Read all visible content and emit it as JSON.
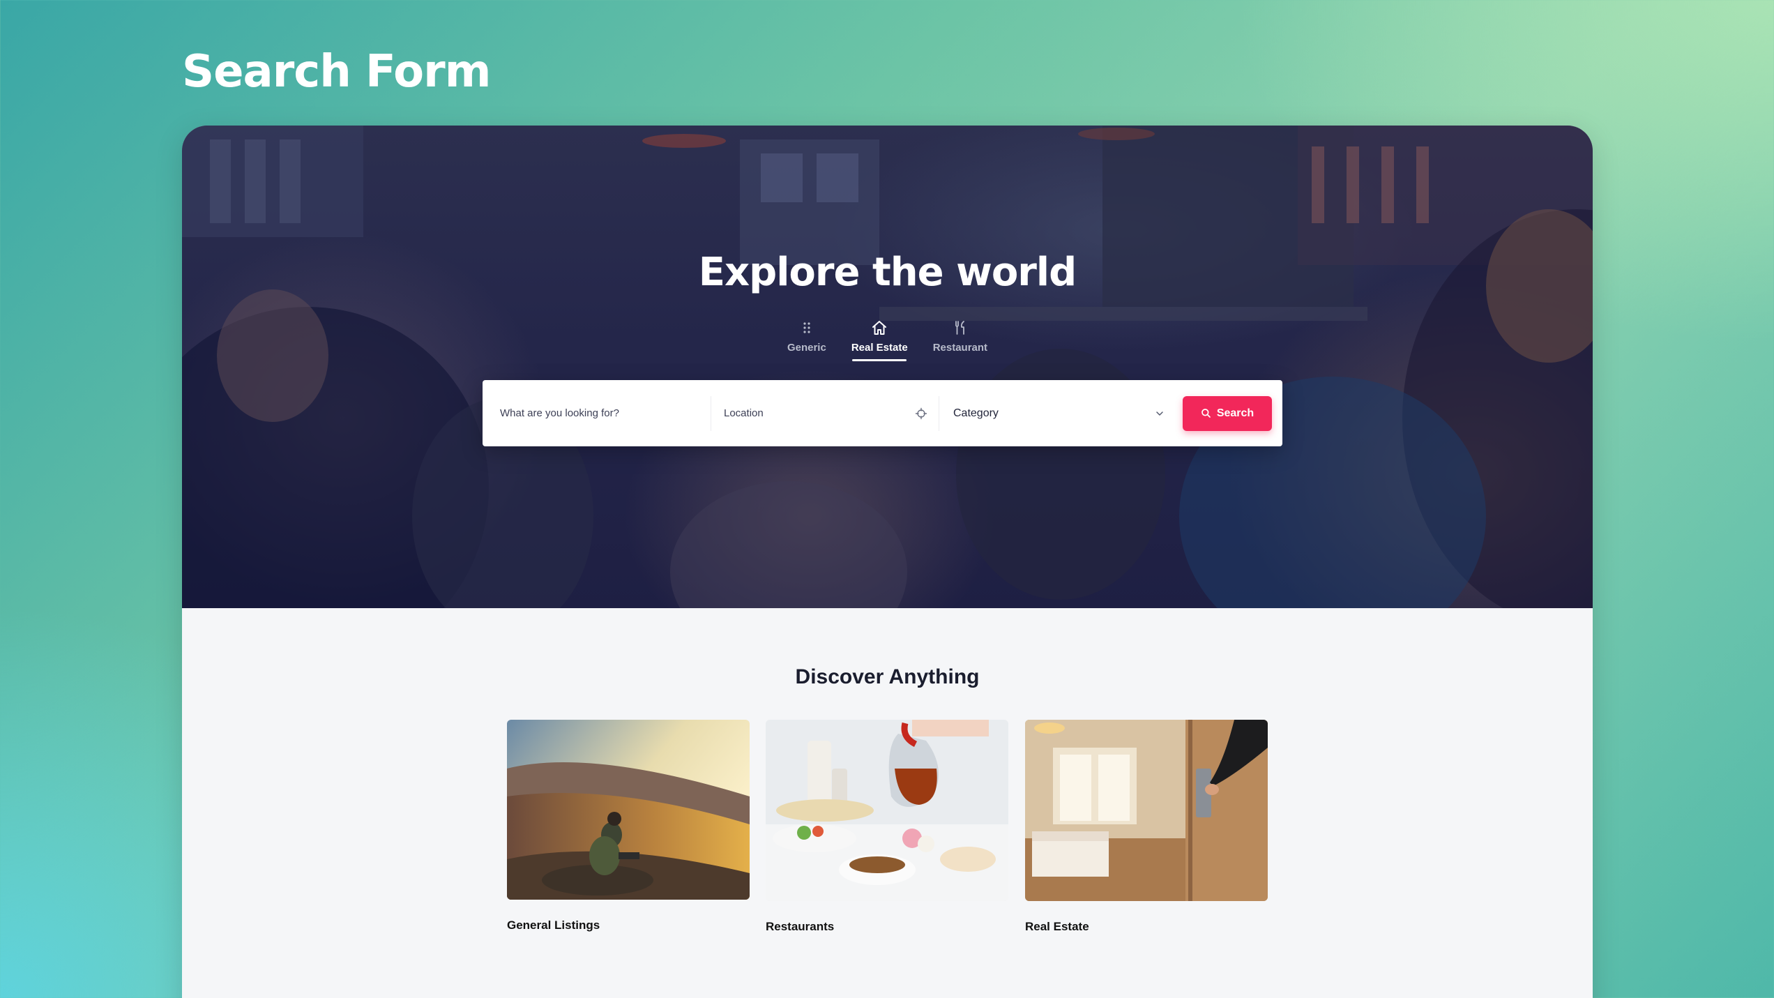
{
  "page": {
    "heading": "Search Form"
  },
  "hero": {
    "title": "Explore the world",
    "tabs": [
      {
        "label": "Generic",
        "icon": "grid-dots-icon",
        "active": false
      },
      {
        "label": "Real Estate",
        "icon": "home-icon",
        "active": true
      },
      {
        "label": "Restaurant",
        "icon": "cutlery-icon",
        "active": false
      }
    ]
  },
  "search": {
    "what_placeholder": "What are you looking for?",
    "location_placeholder": "Location",
    "category_value": "Category",
    "button_label": "Search",
    "button_color": "#f2275a"
  },
  "discover": {
    "title": "Discover Anything",
    "cards": [
      {
        "label": "General Listings",
        "image": "hiker-on-mountain"
      },
      {
        "label": "Restaurants",
        "image": "tea-pouring-breakfast"
      },
      {
        "label": "Real Estate",
        "image": "hotel-room-door"
      }
    ]
  }
}
